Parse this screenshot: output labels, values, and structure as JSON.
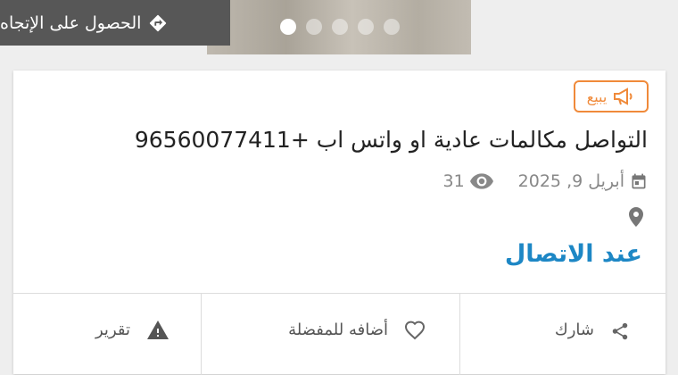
{
  "header": {
    "directions_label": "الحصول على الإتجاه"
  },
  "gallery": {
    "dots": 5,
    "active_index": 0
  },
  "listing": {
    "badge": "يبيع",
    "title": "التواصل مكالمات عادية او واتس اب +96560077411",
    "date": "أبريل 9, 2025",
    "views": "31",
    "price": "عند الاتصال"
  },
  "actions": {
    "share": "شارك",
    "favorite": "أضافه للمفضلة",
    "report": "تقرير"
  },
  "colors": {
    "accent": "#1d87c5",
    "badge": "#f08a3a"
  },
  "icons": [
    "directions-icon",
    "megaphone-icon",
    "calendar-icon",
    "eye-icon",
    "location-pin-icon",
    "share-icon",
    "heart-icon",
    "warning-icon"
  ]
}
